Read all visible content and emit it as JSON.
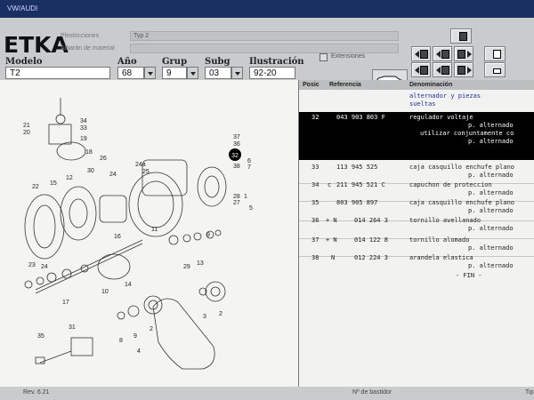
{
  "window": {
    "title": "VW/AUDI"
  },
  "header": {
    "logo": "ETKA",
    "label_1": "Plestricciones",
    "label_2": "Albarán de material",
    "type_value": "Typ 2",
    "extension_label": "Extensiones",
    "fields": [
      {
        "label": "Modelo",
        "value": "T2"
      },
      {
        "label": "Año",
        "value": "68"
      },
      {
        "label": "Grup",
        "value": "9"
      },
      {
        "label": "Subg",
        "value": "03"
      },
      {
        "label": "Ilustración",
        "value": "92-20"
      }
    ]
  },
  "list": {
    "columns": [
      "Posic",
      "Referencia",
      "Denominación"
    ],
    "group_title": [
      "alternador y piezas",
      "sueltas"
    ],
    "rows": [
      {
        "pos": "32",
        "mark": "",
        "ref": "043 903 803 F",
        "desc": "regulador voltaje",
        "lines": [
          "p. alternado",
          "utilizar conjuntamente co",
          "p. alternado"
        ],
        "selected": true
      },
      {
        "pos": "33",
        "mark": "",
        "ref": "113 945 525",
        "desc": "caja casquillo enchufe plano",
        "lines": [
          "p. alternado"
        ],
        "selected": false
      },
      {
        "pos": "34",
        "mark": "c",
        "ref": "211 945 521 C",
        "desc": "capuchon de proteccion",
        "lines": [
          "p. alternado"
        ],
        "selected": false
      },
      {
        "pos": "35",
        "mark": "",
        "ref": "803 905 897",
        "desc": "caja casquillo enchufe plano",
        "lines": [
          "p. alternado"
        ],
        "selected": false
      },
      {
        "pos": "36",
        "mark": "+ N",
        "ref": "014 264 3",
        "desc": "tornillo avellanado",
        "lines": [
          "p. alternado"
        ],
        "selected": false
      },
      {
        "pos": "37",
        "mark": "+ N",
        "ref": "014 122 8",
        "desc": "tornillo alomado",
        "lines": [
          "p. alternado"
        ],
        "selected": false
      },
      {
        "pos": "38",
        "mark": "N",
        "ref": "012 224 3",
        "desc": "arandela elastica",
        "lines": [
          "p. alternado"
        ],
        "selected": false
      }
    ],
    "end_marker": "- FIN -"
  },
  "illustration": {
    "callouts": [
      "21",
      "20",
      "34",
      "33",
      "19",
      "18",
      "30",
      "26",
      "24",
      "22",
      "15",
      "12",
      "16",
      "11",
      "23",
      "10",
      "14",
      "17",
      "31",
      "35",
      "32",
      "37",
      "36",
      "38",
      "6",
      "7",
      "24a",
      "25",
      "28",
      "1",
      "27",
      "5",
      "9",
      "29",
      "13",
      "8",
      "3",
      "2",
      "4"
    ]
  },
  "status": {
    "left": "Rev. 6.21",
    "center": "Nº de bastidor",
    "right": "Tip"
  }
}
